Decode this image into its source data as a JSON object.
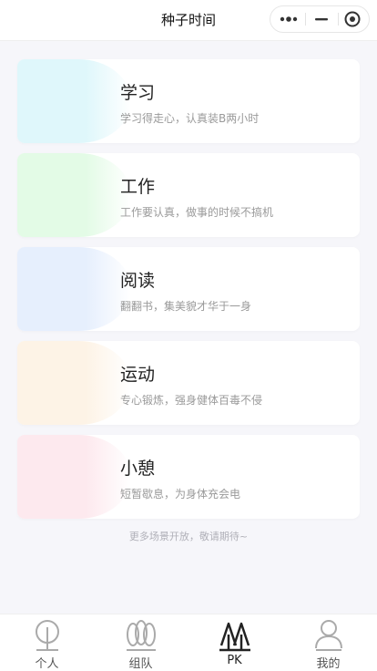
{
  "header": {
    "title": "种子时间"
  },
  "scenes": [
    {
      "title": "学习",
      "desc": "学习得走心，认真装B两小时",
      "color": "#dff7fb"
    },
    {
      "title": "工作",
      "desc": "工作要认真，做事的时候不搞机",
      "color": "#e3fbe6"
    },
    {
      "title": "阅读",
      "desc": "翻翻书，集美貌才华于一身",
      "color": "#e6effd"
    },
    {
      "title": "运动",
      "desc": "专心锻炼，强身健体百毒不侵",
      "color": "#fdf3e6"
    },
    {
      "title": "小憩",
      "desc": "短暂歇息，为身体充会电",
      "color": "#fde9ee"
    }
  ],
  "footer_note": "更多场景开放，敬请期待~",
  "tabs": [
    {
      "label": "个人",
      "icon": "tree-round-icon",
      "active": false
    },
    {
      "label": "组队",
      "icon": "trees-group-icon",
      "active": false
    },
    {
      "label": "PK",
      "icon": "pine-trees-icon",
      "active": true
    },
    {
      "label": "我的",
      "icon": "user-icon",
      "active": false
    }
  ],
  "colors": {
    "icon_inactive": "#aaaaaa",
    "icon_active": "#222222"
  }
}
